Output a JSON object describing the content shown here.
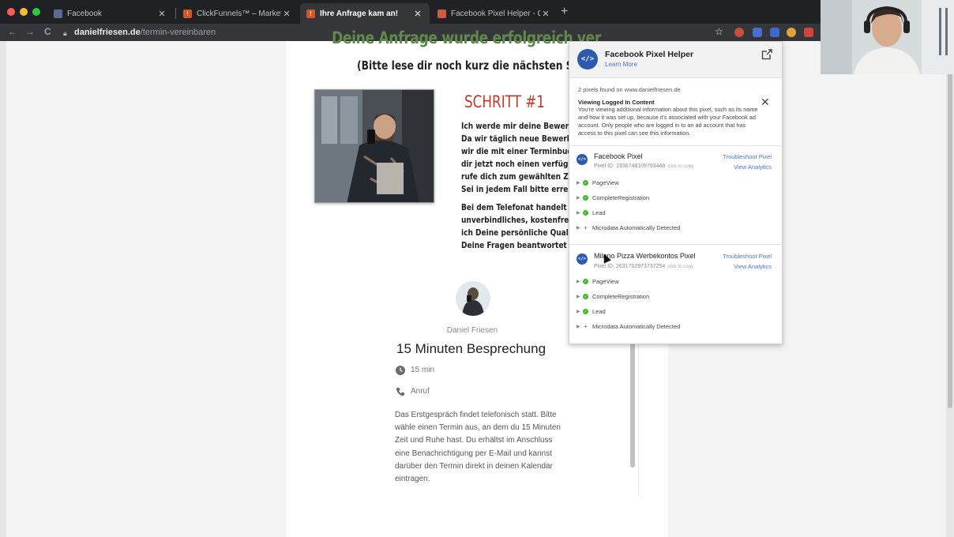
{
  "tabs": [
    {
      "title": "Facebook",
      "active": false
    },
    {
      "title": "ClickFunnels™ – Marketing Fu",
      "active": false
    },
    {
      "title": "Ihre Anfrage kam an!",
      "active": true
    },
    {
      "title": "Facebook Pixel Helper - Chron",
      "active": false
    }
  ],
  "address": {
    "domain": "danielfriesen.de",
    "path": "/termin-vereinbaren"
  },
  "page": {
    "headline": "Deine Anfrage wurde erfolgreich ver",
    "subheadline": "(Bitte lese dir noch kurz die nächsten Schritte d",
    "step_title": "SCHRITT #1",
    "step_lines": [
      "Ich werde mir deine Bewerbung",
      "Da wir täglich neue Bewerbunger",
      "wir die mit einer Terminbuchung",
      "dir jetzt noch einen verfügbaren",
      "rufe dich zum gewählten Zeitpun",
      "Sei in jedem Fall bitte erreichbar"
    ],
    "step_lines_2": [
      "Bei dem Telefonat handelt es sicl",
      "unverbindliches, kostenfreies Ers",
      "ich Deine persönliche Qualifikati",
      "Deine Fragen beantwortet werde"
    ]
  },
  "booking": {
    "organizer": "Daniel Friesen",
    "event_title": "15 Minuten Besprechung",
    "duration": "15 min",
    "location": "Anruf",
    "description": "Das Erstgespräch findet telefonisch statt. Bitte wähle einen Termin aus, an dem du 15 Minuten Zeit und Ruhe hast. Du erhältst im Anschluss eine Benachrichtigung per E-Mail und kannst darüber den Termin direkt in deinen Kalendar eintragen."
  },
  "pixel_helper": {
    "title": "Facebook Pixel Helper",
    "learn_more": "Learn More",
    "found": "2 pixels found on www.danielfriesen.de",
    "notice_title": "Viewing Logged In Content",
    "notice_text": "You're viewing additional information about this pixel, such as its name and how it was set up, because it's associated with your Facebook ad account. Only people who are logged in to an ad account that has access to this pixel can see this information.",
    "pixels": [
      {
        "name": "Facebook Pixel",
        "pixel_id": "Pixel ID: 1936748109793448",
        "copy_hint": "click to copy",
        "troubleshoot": "Troubleshoot Pixel",
        "analytics": "View Analytics",
        "events": [
          "PageView",
          "CompleteRegistration",
          "Lead"
        ],
        "microdata": "Microdata Automatically Detected"
      },
      {
        "name": "Milano Pizza Werbekontos Pixel",
        "pixel_id": "Pixel ID: 2631702973737254",
        "copy_hint": "click to copy",
        "troubleshoot": "Troubleshoot Pixel",
        "analytics": "View Analytics",
        "events": [
          "PageView",
          "CompleteRegistration",
          "Lead"
        ],
        "microdata": "Microdata Automatically Detected"
      }
    ]
  },
  "colors": {
    "headline": "#5f8a4a",
    "step_title": "#c0392b",
    "pixel_blue": "#2e59b0",
    "link_blue": "#4a76c9",
    "event_ok": "#42b72a"
  }
}
